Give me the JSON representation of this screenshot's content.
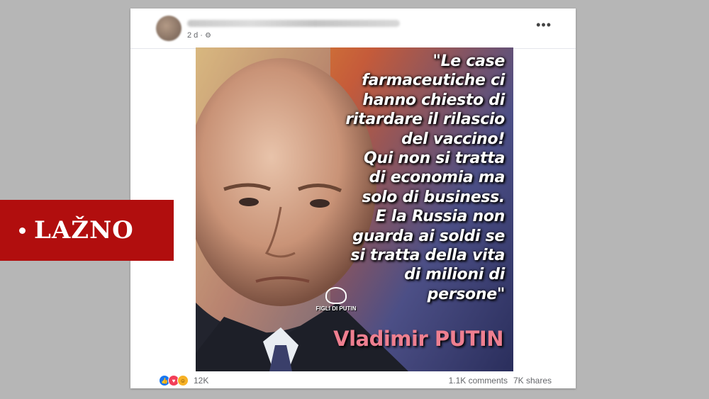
{
  "post": {
    "time": "2 d",
    "separator": "·",
    "more_label": "•••",
    "quote": "\"Le case\nfarmaceutiche ci\nhanno chiesto di\nritardare il rilascio\ndel vaccino!\nQui non si tratta\ndi economia ma\nsolo di business.\nE la Russia non\nguarda ai soldi se\nsi tratta della vita\ndi milioni di\npersone\"",
    "signature": "Vladimir PUTIN",
    "watermark": "FIGLI DI PUTIN",
    "reactions_count": "12K",
    "comments": "1.1K comments",
    "shares": "7K shares"
  },
  "verdict": {
    "label": "LAŽNO",
    "color": "#b10e0e"
  },
  "icons": [
    "gear-icon",
    "more-options-icon",
    "like-reaction-icon",
    "love-reaction-icon",
    "haha-reaction-icon"
  ]
}
